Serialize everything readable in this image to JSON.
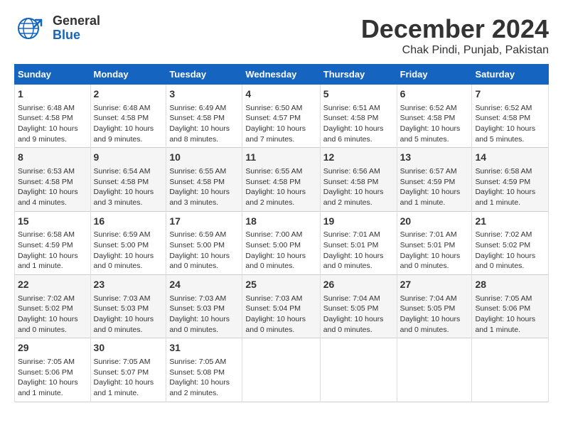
{
  "logo": {
    "general": "General",
    "blue": "Blue"
  },
  "title": "December 2024",
  "location": "Chak Pindi, Punjab, Pakistan",
  "days_of_week": [
    "Sunday",
    "Monday",
    "Tuesday",
    "Wednesday",
    "Thursday",
    "Friday",
    "Saturday"
  ],
  "weeks": [
    [
      {
        "day": "1",
        "info": "Sunrise: 6:48 AM\nSunset: 4:58 PM\nDaylight: 10 hours\nand 9 minutes."
      },
      {
        "day": "2",
        "info": "Sunrise: 6:48 AM\nSunset: 4:58 PM\nDaylight: 10 hours\nand 9 minutes."
      },
      {
        "day": "3",
        "info": "Sunrise: 6:49 AM\nSunset: 4:58 PM\nDaylight: 10 hours\nand 8 minutes."
      },
      {
        "day": "4",
        "info": "Sunrise: 6:50 AM\nSunset: 4:57 PM\nDaylight: 10 hours\nand 7 minutes."
      },
      {
        "day": "5",
        "info": "Sunrise: 6:51 AM\nSunset: 4:58 PM\nDaylight: 10 hours\nand 6 minutes."
      },
      {
        "day": "6",
        "info": "Sunrise: 6:52 AM\nSunset: 4:58 PM\nDaylight: 10 hours\nand 5 minutes."
      },
      {
        "day": "7",
        "info": "Sunrise: 6:52 AM\nSunset: 4:58 PM\nDaylight: 10 hours\nand 5 minutes."
      }
    ],
    [
      {
        "day": "8",
        "info": "Sunrise: 6:53 AM\nSunset: 4:58 PM\nDaylight: 10 hours\nand 4 minutes."
      },
      {
        "day": "9",
        "info": "Sunrise: 6:54 AM\nSunset: 4:58 PM\nDaylight: 10 hours\nand 3 minutes."
      },
      {
        "day": "10",
        "info": "Sunrise: 6:55 AM\nSunset: 4:58 PM\nDaylight: 10 hours\nand 3 minutes."
      },
      {
        "day": "11",
        "info": "Sunrise: 6:55 AM\nSunset: 4:58 PM\nDaylight: 10 hours\nand 2 minutes."
      },
      {
        "day": "12",
        "info": "Sunrise: 6:56 AM\nSunset: 4:58 PM\nDaylight: 10 hours\nand 2 minutes."
      },
      {
        "day": "13",
        "info": "Sunrise: 6:57 AM\nSunset: 4:59 PM\nDaylight: 10 hours\nand 1 minute."
      },
      {
        "day": "14",
        "info": "Sunrise: 6:58 AM\nSunset: 4:59 PM\nDaylight: 10 hours\nand 1 minute."
      }
    ],
    [
      {
        "day": "15",
        "info": "Sunrise: 6:58 AM\nSunset: 4:59 PM\nDaylight: 10 hours\nand 1 minute."
      },
      {
        "day": "16",
        "info": "Sunrise: 6:59 AM\nSunset: 5:00 PM\nDaylight: 10 hours\nand 0 minutes."
      },
      {
        "day": "17",
        "info": "Sunrise: 6:59 AM\nSunset: 5:00 PM\nDaylight: 10 hours\nand 0 minutes."
      },
      {
        "day": "18",
        "info": "Sunrise: 7:00 AM\nSunset: 5:00 PM\nDaylight: 10 hours\nand 0 minutes."
      },
      {
        "day": "19",
        "info": "Sunrise: 7:01 AM\nSunset: 5:01 PM\nDaylight: 10 hours\nand 0 minutes."
      },
      {
        "day": "20",
        "info": "Sunrise: 7:01 AM\nSunset: 5:01 PM\nDaylight: 10 hours\nand 0 minutes."
      },
      {
        "day": "21",
        "info": "Sunrise: 7:02 AM\nSunset: 5:02 PM\nDaylight: 10 hours\nand 0 minutes."
      }
    ],
    [
      {
        "day": "22",
        "info": "Sunrise: 7:02 AM\nSunset: 5:02 PM\nDaylight: 10 hours\nand 0 minutes."
      },
      {
        "day": "23",
        "info": "Sunrise: 7:03 AM\nSunset: 5:03 PM\nDaylight: 10 hours\nand 0 minutes."
      },
      {
        "day": "24",
        "info": "Sunrise: 7:03 AM\nSunset: 5:03 PM\nDaylight: 10 hours\nand 0 minutes."
      },
      {
        "day": "25",
        "info": "Sunrise: 7:03 AM\nSunset: 5:04 PM\nDaylight: 10 hours\nand 0 minutes."
      },
      {
        "day": "26",
        "info": "Sunrise: 7:04 AM\nSunset: 5:05 PM\nDaylight: 10 hours\nand 0 minutes."
      },
      {
        "day": "27",
        "info": "Sunrise: 7:04 AM\nSunset: 5:05 PM\nDaylight: 10 hours\nand 0 minutes."
      },
      {
        "day": "28",
        "info": "Sunrise: 7:05 AM\nSunset: 5:06 PM\nDaylight: 10 hours\nand 1 minute."
      }
    ],
    [
      {
        "day": "29",
        "info": "Sunrise: 7:05 AM\nSunset: 5:06 PM\nDaylight: 10 hours\nand 1 minute."
      },
      {
        "day": "30",
        "info": "Sunrise: 7:05 AM\nSunset: 5:07 PM\nDaylight: 10 hours\nand 1 minute."
      },
      {
        "day": "31",
        "info": "Sunrise: 7:05 AM\nSunset: 5:08 PM\nDaylight: 10 hours\nand 2 minutes."
      },
      {
        "day": "",
        "info": ""
      },
      {
        "day": "",
        "info": ""
      },
      {
        "day": "",
        "info": ""
      },
      {
        "day": "",
        "info": ""
      }
    ]
  ]
}
